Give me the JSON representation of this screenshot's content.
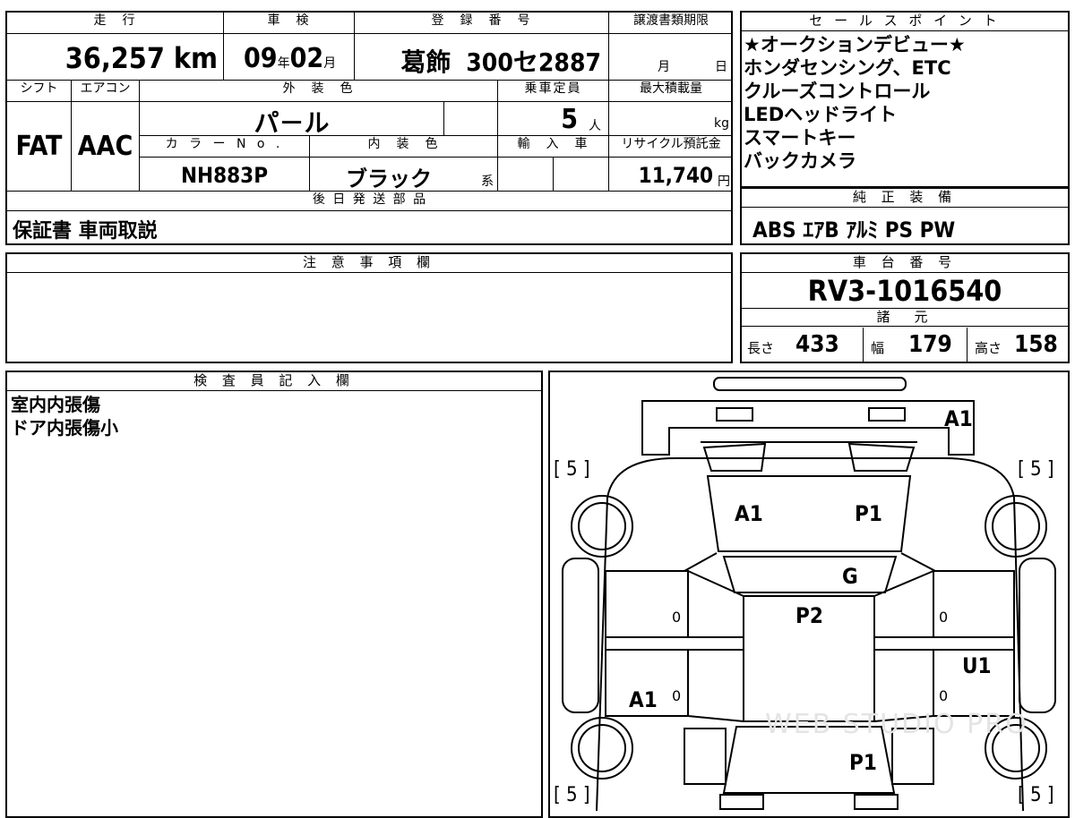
{
  "headers": {
    "mileage": "走　行",
    "inspection": "車　検",
    "registration": "登　録　番　号",
    "transfer_deadline": "譲渡書類期限",
    "sales_points": "セ ー ル ス ポ イ ン ト",
    "shift": "シフト",
    "aircon": "エアコン",
    "exterior_color": "外　装　色",
    "capacity": "乗車定員",
    "max_load": "最大積載量",
    "color_no": "カ ラ ー N o .",
    "interior_color": "内　装　色",
    "import": "輸　入　車",
    "recycle_fee": "リサイクル預託金",
    "later_parts": "後 日 発 送 部 品",
    "genuine_equipment": "純 正 装 備",
    "notes": "注 意 事 項 欄",
    "chassis_no": "車 台 番 号",
    "specs": "諸　元",
    "inspector": "検 査 員 記 入 欄"
  },
  "vehicle": {
    "mileage_value": "36,257",
    "mileage_unit": "km",
    "inspection_year": "09",
    "inspection_year_unit": "年",
    "inspection_month": "02",
    "inspection_month_unit": "月",
    "plate_region": "葛飾",
    "plate_class": "300",
    "plate_kana": "セ",
    "plate_number": "2887",
    "transfer_month_unit": "月",
    "transfer_day_unit": "日",
    "shift": "FAT",
    "aircon": "AAC",
    "exterior_color": "パ－ル",
    "capacity_value": "5",
    "capacity_unit": "人",
    "max_load_unit": "kg",
    "color_no": "NH883P",
    "interior_color": "ブラック",
    "interior_suffix": "系",
    "recycle_value": "11,740",
    "recycle_unit": "円",
    "later_parts": "保証書 車両取説",
    "chassis_no": "RV3-1016540",
    "length_label": "長さ",
    "length_value": "433",
    "width_label": "幅",
    "width_value": "179",
    "height_label": "高さ",
    "height_value": "158"
  },
  "sales_points": [
    "★オークションデビュー★",
    "ホンダセンシング、ETC",
    "クルーズコントロール",
    "LEDヘッドライト",
    "スマートキー",
    "バックカメラ"
  ],
  "genuine_equipment": "ABS ｴｱB ｱﾙﾐ PS PW",
  "notes": "",
  "inspector_notes": [
    "室内内張傷",
    "ドア内張傷小"
  ],
  "diagram": {
    "tire_marks": [
      "[ 5 ]",
      "[ 5 ]",
      "[ 5 ]",
      "[ 5 ]"
    ],
    "damage": {
      "front_bumper": "A1",
      "hood_left": "A1",
      "hood_right": "P1",
      "windshield": "G",
      "roof": "P2",
      "right_rear_door": "U1",
      "left_rear_door": "A1",
      "rear": "P1"
    },
    "pillar_marks": [
      "0",
      "0",
      "0",
      "0"
    ],
    "watermark": "WEB STUDIO PRO"
  }
}
